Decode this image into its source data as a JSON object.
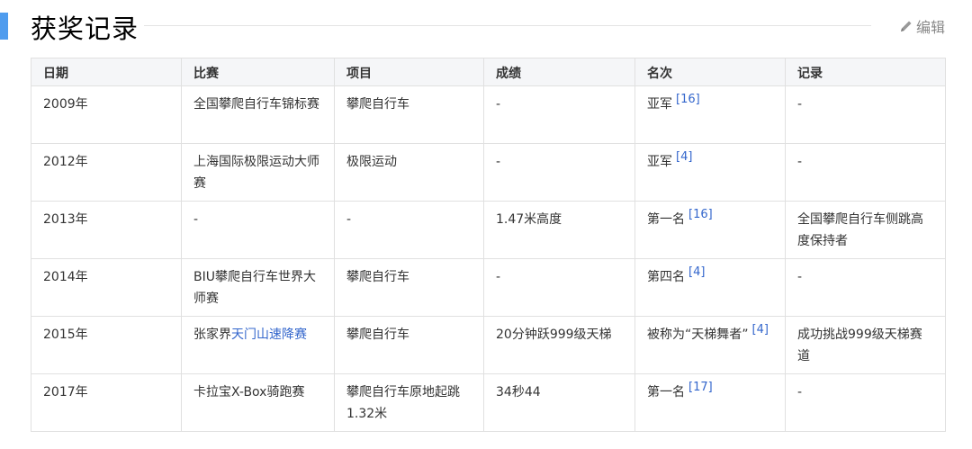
{
  "section": {
    "title": "获奖记录",
    "edit_label": "编辑"
  },
  "table": {
    "headers": [
      "日期",
      "比赛",
      "项目",
      "成绩",
      "名次",
      "记录"
    ],
    "rows": [
      {
        "date": "2009年",
        "competition": "全国攀爬自行车锦标赛",
        "event": "攀爬自行车",
        "result": "-",
        "rank": "亚军",
        "rank_ref": "[16]",
        "record": "-"
      },
      {
        "date": "2012年",
        "competition": "上海国际极限运动大师赛",
        "event": "极限运动",
        "result": "-",
        "rank": "亚军",
        "rank_ref": "[4]",
        "record": "-"
      },
      {
        "date": "2013年",
        "competition": "-",
        "event": "-",
        "result": "1.47米高度",
        "rank": "第一名",
        "rank_ref": "[16]",
        "record": "全国攀爬自行车侧跳高度保持者"
      },
      {
        "date": "2014年",
        "competition": "BIU攀爬自行车世界大师赛",
        "event": "攀爬自行车",
        "result": "-",
        "rank": "第四名",
        "rank_ref": "[4]",
        "record": "-"
      },
      {
        "date": "2015年",
        "competition_prefix": "张家界",
        "competition_link": "天门山速降赛",
        "event": "攀爬自行车",
        "result": "20分钟跃999级天梯",
        "rank": "被称为“天梯舞者”",
        "rank_ref": "[4]",
        "record": "成功挑战999级天梯赛道"
      },
      {
        "date": "2017年",
        "competition": "卡拉宝X-Box骑跑赛",
        "event": "攀爬自行车原地起跳1.32米",
        "result": "34秒44",
        "rank": "第一名",
        "rank_ref": "[17]",
        "record": "-"
      }
    ]
  },
  "colors": {
    "accent": "#4f9cee",
    "link": "#3366cc",
    "header_bg": "#f5f6f8",
    "border": "#e0e0e0"
  },
  "icons": {
    "edit": "pencil-icon"
  }
}
